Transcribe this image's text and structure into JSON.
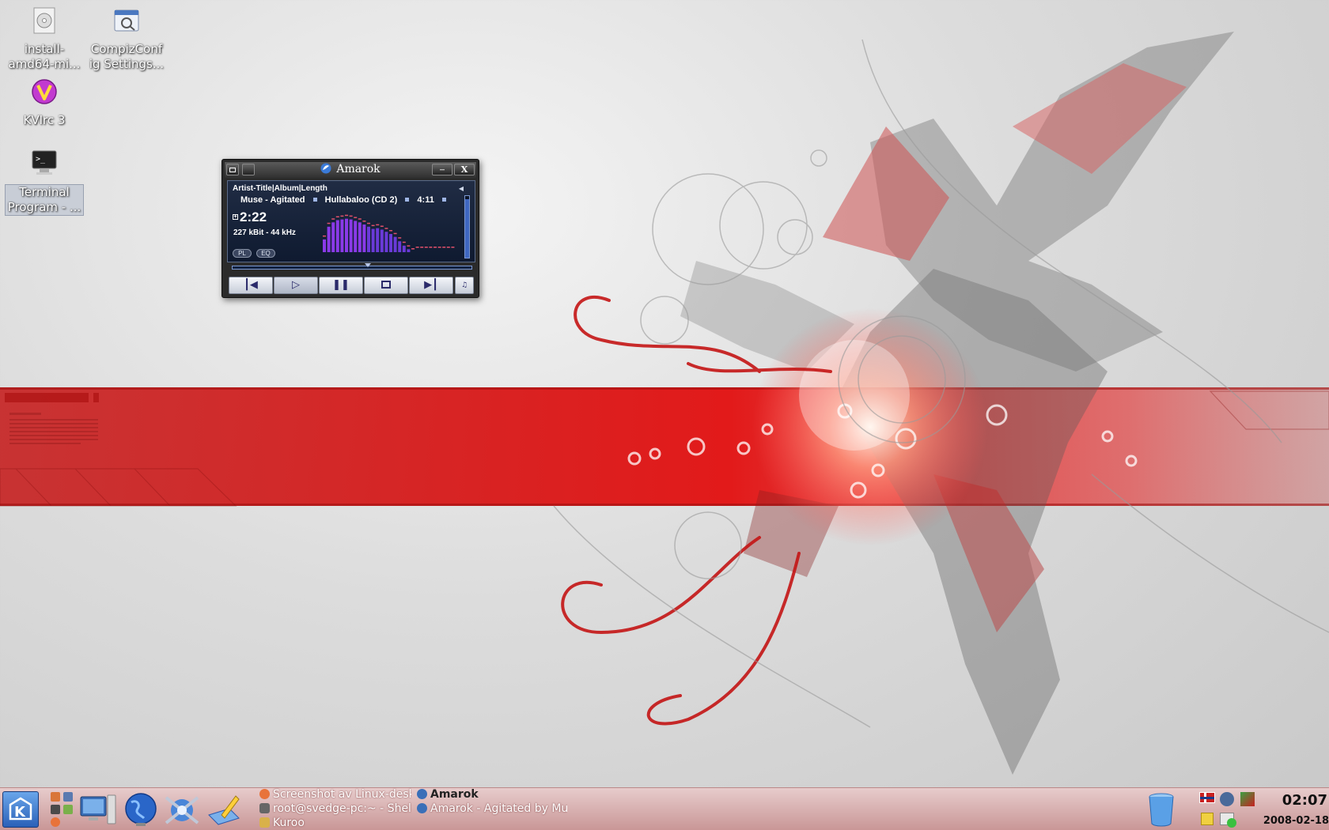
{
  "desktop": {
    "icons": [
      {
        "label_line1": "install-",
        "label_line2": "amd64-mi..."
      },
      {
        "label_line1": "CompizConf",
        "label_line2": "ig Settings..."
      },
      {
        "label_line1": "KVIrc 3",
        "label_line2": ""
      },
      {
        "label_line1": "Terminal",
        "label_line2": "Program - ..."
      }
    ]
  },
  "amarok": {
    "title": "Amarok",
    "close_label": "X",
    "minimize_label": "‒",
    "columns_header": "Artist-Title|Album|Length",
    "track_artist_title": "Muse - Agitated",
    "track_album": "Hullabaloo (CD 2)",
    "track_length": "4:11",
    "track_scroll_tail": "Mu",
    "elapsed_time": "2:22",
    "bitrate_info": "227 kBit - 44 kHz",
    "pl_label": "PL",
    "eq_label": "EQ",
    "seek_fraction": 0.57,
    "volume_fraction": 0.95,
    "analyzer_levels": [
      0.35,
      0.7,
      0.82,
      0.88,
      0.9,
      0.92,
      0.9,
      0.86,
      0.82,
      0.76,
      0.7,
      0.64,
      0.66,
      0.62,
      0.56,
      0.5,
      0.42,
      0.3,
      0.18,
      0.08,
      0.0,
      0.0,
      0.0,
      0.0,
      0.0,
      0.0,
      0.0,
      0.0,
      0.0,
      0.0
    ]
  },
  "taskbar": {
    "tasks": [
      {
        "label": "Screenshot av Linux-desk",
        "color": "#e8733a"
      },
      {
        "label": "root@svedge-pc:~ - Shell",
        "color": "#666666"
      },
      {
        "label": "Kuroo",
        "color": "#d9b14a"
      },
      {
        "label": "Amarok",
        "color": "#3a6fb8"
      },
      {
        "label": "Amarok - Agitated by Mus",
        "color": "#3a6fb8"
      }
    ],
    "clock": "02:07",
    "date": "2008-02-18",
    "colors": {
      "accent": "#c99797",
      "wallpaper_red": "#d42020"
    }
  }
}
